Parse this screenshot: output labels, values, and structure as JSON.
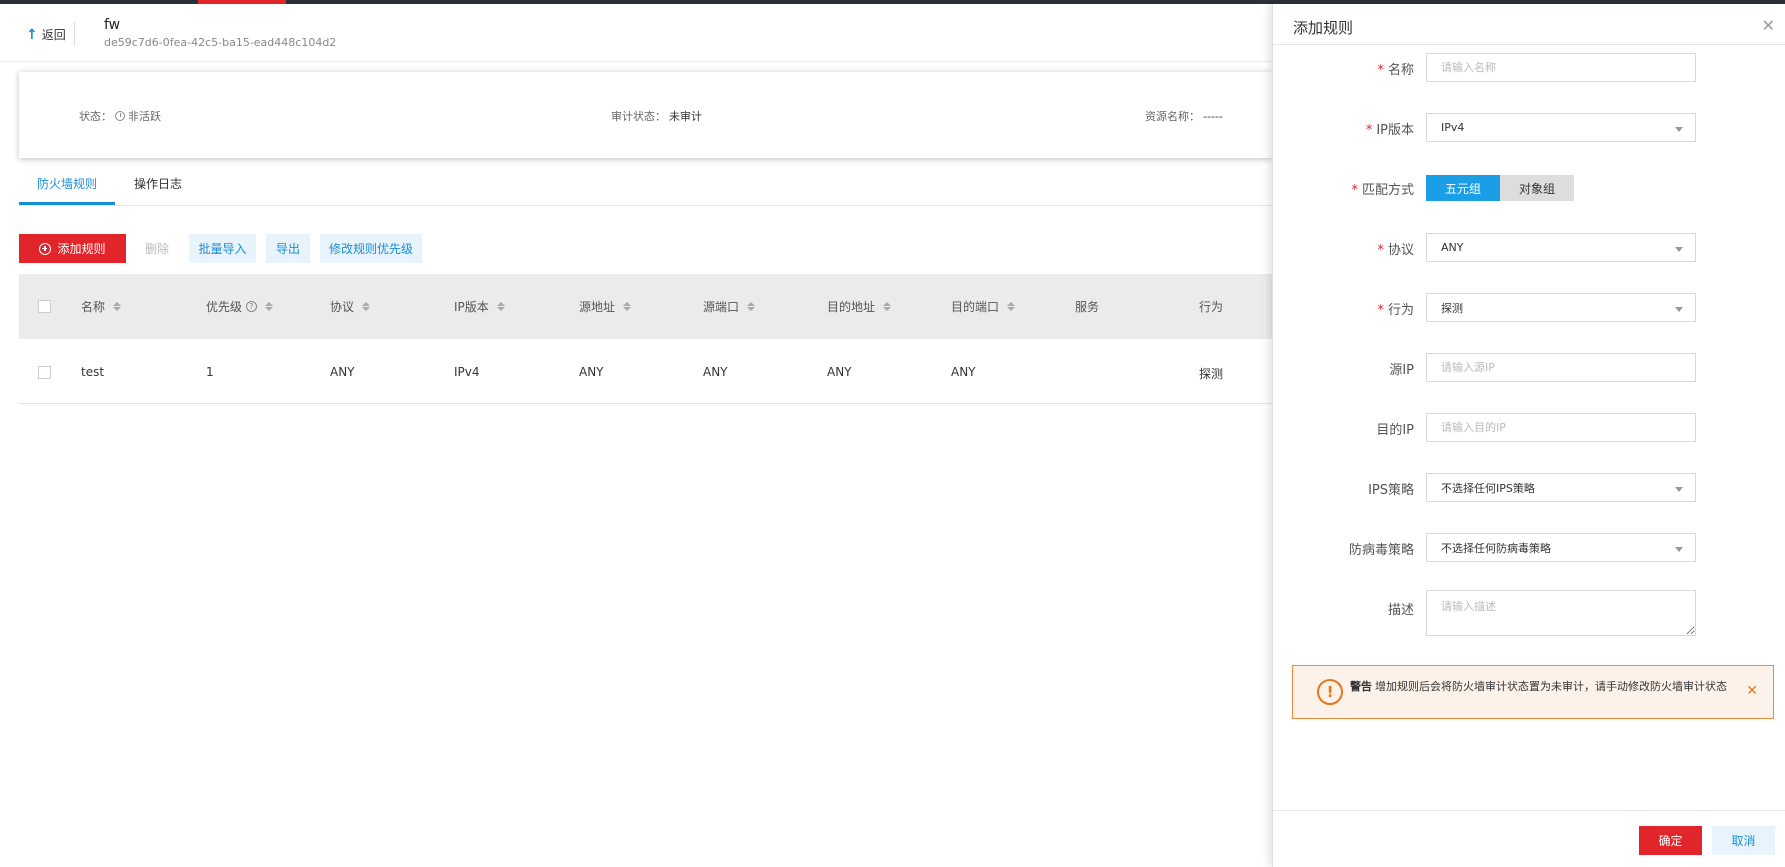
{
  "header": {
    "back_label": "返回",
    "fw_name": "fw",
    "fw_id": "de59c7d6-0fea-42c5-ba15-ead448c104d2"
  },
  "status_card": {
    "status_label": "状态：",
    "status_value": "非活跃",
    "audit_label": "审计状态：",
    "audit_value": "未审计",
    "resource_label": "资源名称：",
    "resource_value": "-----"
  },
  "tabs": [
    {
      "label": "防火墙规则",
      "active": true
    },
    {
      "label": "操作日志",
      "active": false
    }
  ],
  "toolbar": {
    "add_label": "添加规则",
    "delete_label": "删除",
    "import_label": "批量导入",
    "export_label": "导出",
    "priority_label": "修改规则优先级"
  },
  "table": {
    "columns": [
      "名称",
      "优先级",
      "协议",
      "IP版本",
      "源地址",
      "源端口",
      "目的地址",
      "目的端口",
      "服务",
      "行为"
    ],
    "rows": [
      [
        "test",
        "1",
        "ANY",
        "IPv4",
        "ANY",
        "ANY",
        "ANY",
        "ANY",
        "",
        "探测"
      ]
    ]
  },
  "drawer": {
    "title": "添加规则",
    "fields": {
      "name": {
        "label": "名称",
        "placeholder": "请输入名称",
        "required": true
      },
      "ip_version": {
        "label": "IP版本",
        "value": "IPv4",
        "required": true
      },
      "match": {
        "label": "匹配方式",
        "options": [
          "五元组",
          "对象组"
        ],
        "selected": "五元组",
        "required": true
      },
      "protocol": {
        "label": "协议",
        "value": "ANY",
        "required": true
      },
      "action": {
        "label": "行为",
        "value": "探测",
        "required": true
      },
      "src_ip": {
        "label": "源IP",
        "placeholder": "请输入源IP"
      },
      "dst_ip": {
        "label": "目的IP",
        "placeholder": "请输入目的IP"
      },
      "ips": {
        "label": "IPS策略",
        "value": "不选择任何IPS策略"
      },
      "antivirus": {
        "label": "防病毒策略",
        "value": "不选择任何防病毒策略"
      },
      "desc": {
        "label": "描述",
        "placeholder": "请输入描述"
      }
    },
    "warning": {
      "title": "警告",
      "text": "增加规则后会将防火墙审计状态置为未审计，请手动修改防火墙审计状态"
    },
    "ok_label": "确定",
    "cancel_label": "取消",
    "required_mark": "*"
  },
  "colors": {
    "accent_red": "#e1252b",
    "accent_blue": "#1a8dd6",
    "warning_orange": "#e8751a"
  }
}
